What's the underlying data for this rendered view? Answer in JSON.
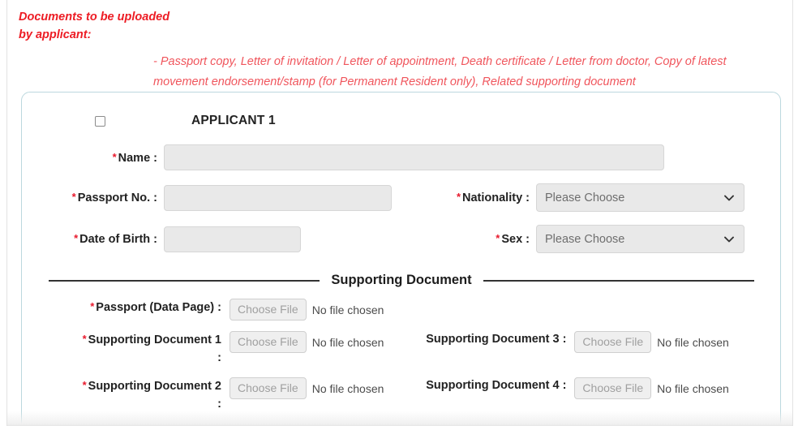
{
  "notice": {
    "title_line1": "Documents to be uploaded",
    "title_line2": "by applicant:",
    "body": "- Passport copy, Letter of invitation / Letter of appointment, Death certificate / Letter from doctor, Copy of latest movement endorsement/stamp (for Permanent Resident only), Related supporting document",
    "title_color": "#ed1c24",
    "body_color": "#f0555c"
  },
  "applicant": {
    "heading": "APPLICANT 1",
    "checkbox_checked": false,
    "required_marker": "*",
    "fields": {
      "name": {
        "label": "Name :",
        "required": true,
        "value": "",
        "placeholder": ""
      },
      "passport_no": {
        "label": "Passport No. :",
        "required": true,
        "value": "",
        "placeholder": ""
      },
      "date_of_birth": {
        "label": "Date of Birth :",
        "required": true,
        "value": "",
        "placeholder": ""
      },
      "nationality": {
        "label": "Nationality :",
        "required": true,
        "selected": "Please Choose"
      },
      "sex": {
        "label": "Sex :",
        "required": true,
        "selected": "Please Choose"
      }
    }
  },
  "supporting_document": {
    "section_title": "Supporting Document",
    "choose_file_label": "Choose File",
    "no_file_label": "No file chosen",
    "rows": [
      {
        "label": "Passport (Data Page) :",
        "required": true,
        "status": "No file chosen"
      },
      {
        "label": "Supporting Document 1",
        "label_colon": ":",
        "required": true,
        "status": "No file chosen"
      },
      {
        "label": "Supporting Document 3 :",
        "required": false,
        "status": "No file chosen"
      },
      {
        "label": "Supporting Document 2",
        "label_colon": ":",
        "required": true,
        "status": "No file chosen"
      },
      {
        "label": "Supporting Document 4 :",
        "required": false,
        "status": "No file chosen"
      }
    ]
  },
  "colors": {
    "required_star": "#e8192c",
    "panel_border": "#bcd8de",
    "input_fill": "#e9e9e9"
  }
}
